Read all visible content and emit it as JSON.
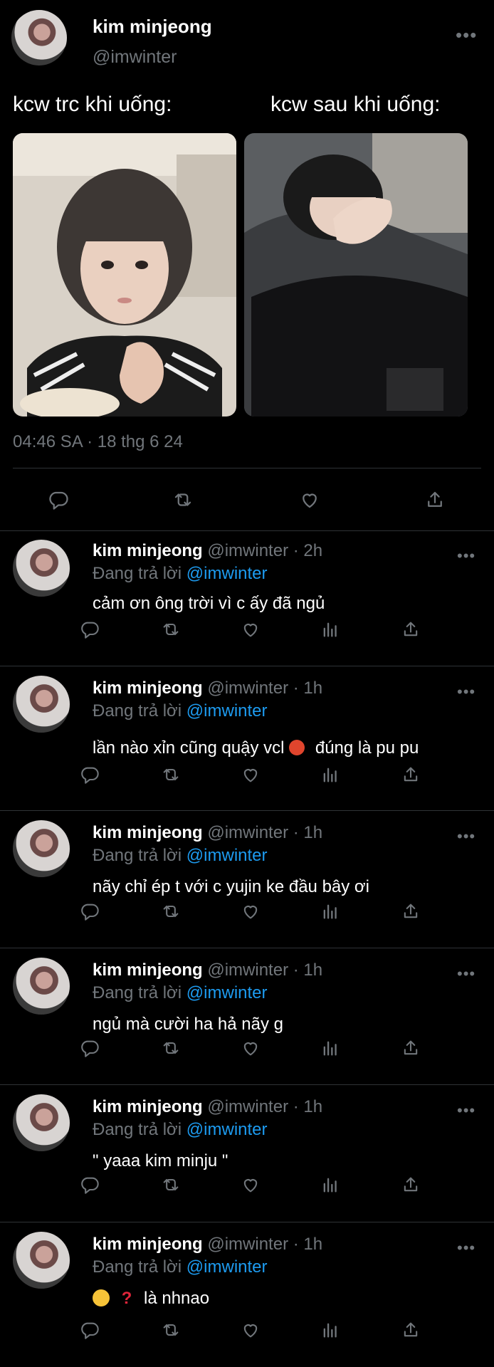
{
  "tweet": {
    "name": "kim minjeong",
    "handle": "@imwinter",
    "text_left": "kcw trc khi uống:",
    "text_right": "kcw sau khi uống:",
    "timestamp": "04:46 SA · 18 thg 6 24",
    "more": "•••"
  },
  "replies": [
    {
      "name": "kim minjeong",
      "handle_time": "@imwinter · 2h",
      "replying": "Đang trả lời",
      "to": "@imwinter",
      "text": "cảm ơn ông trời vì c ấy đã ngủ",
      "more": "•••"
    },
    {
      "name": "kim minjeong",
      "handle_time": "@imwinter · 1h",
      "replying": "Đang trả lời",
      "to": "@imwinter",
      "text_a": "lần nào xỉn cũng quậy vcl",
      "text_b": "đúng là pu pu",
      "more": "•••"
    },
    {
      "name": "kim minjeong",
      "handle_time": "@imwinter · 1h",
      "replying": "Đang trả lời",
      "to": "@imwinter",
      "text": "nãy chỉ ép t với c yujin ke đầu bây ơi",
      "more": "•••"
    },
    {
      "name": "kim minjeong",
      "handle_time": "@imwinter · 1h",
      "replying": "Đang trả lời",
      "to": "@imwinter",
      "text": "ngủ mà cười ha hả nãy g",
      "more": "•••"
    },
    {
      "name": "kim minjeong",
      "handle_time": "@imwinter · 1h",
      "replying": "Đang trả lời",
      "to": "@imwinter",
      "text": "\" yaaa kim minju \"",
      "more": "•••"
    },
    {
      "name": "kim minjeong",
      "handle_time": "@imwinter · 1h",
      "replying": "Đang trả lời",
      "to": "@imwinter",
      "text": "là nhnao",
      "q": "?",
      "more": "•••"
    }
  ],
  "icons": {
    "reply": "reply-icon",
    "retweet": "retweet-icon",
    "like": "like-icon",
    "views": "views-icon",
    "share": "share-icon"
  },
  "colors": {
    "background": "#000000",
    "link": "#1d9bf0",
    "muted": "#71767b"
  }
}
